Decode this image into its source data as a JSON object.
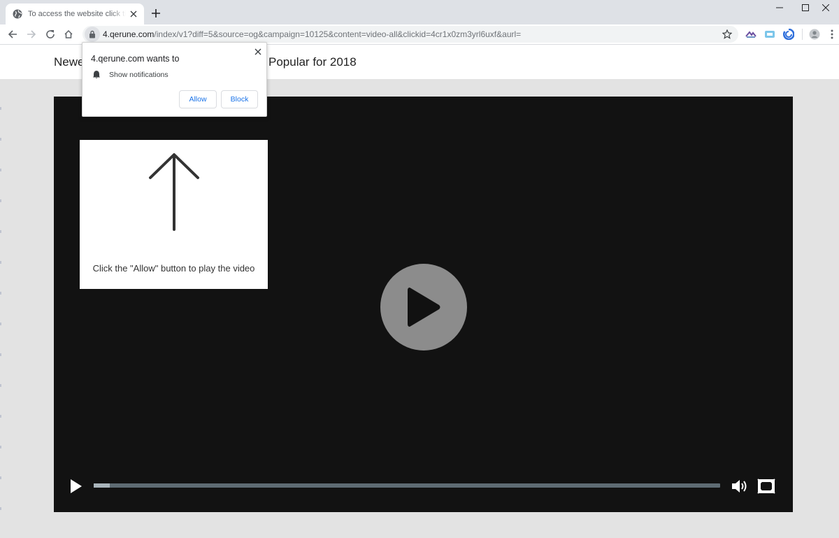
{
  "browser": {
    "tab": {
      "title": "To access the website click the \"Allow\" button",
      "favicon": "globe-icon",
      "close_icon": "close-icon"
    },
    "new_tab_icon": "plus-icon",
    "window_controls": [
      "minimize-icon",
      "maximize-icon",
      "close-icon"
    ],
    "toolbar": {
      "back_icon": "arrow-left-icon",
      "forward_icon": "arrow-right-icon",
      "reload_icon": "reload-icon",
      "home_icon": "home-icon",
      "url_host": "4.qerune.com",
      "url_path": "/index/v1?diff=5&source=og&campaign=10125&content=video-all&clickid=4cr1x0zm3yrl6uxf&aurl=",
      "bookmark_icon": "star-icon",
      "extensions": [
        "extension-icon-1",
        "extension-icon-2",
        "extension-icon-3"
      ],
      "profile_icon": "profile-icon",
      "menu_icon": "kebab-menu-icon"
    }
  },
  "permission_prompt": {
    "title": "4.qerune.com wants to",
    "permission_icon": "bell-icon",
    "permission": "Show notifications",
    "allow_label": "Allow",
    "block_label": "Block"
  },
  "page": {
    "header_left": "Newe",
    "header_right": "Popular for 2018",
    "instruction": {
      "icon": "arrow-up-icon",
      "text": "Click the \"Allow\" button to play the video"
    },
    "video": {
      "progress": 0.026,
      "colors": {
        "background": "#121212",
        "play_circle": "#8c8c8c",
        "progress_track": "#5e6b73",
        "progress_fill": "#a9b4bb"
      }
    }
  }
}
